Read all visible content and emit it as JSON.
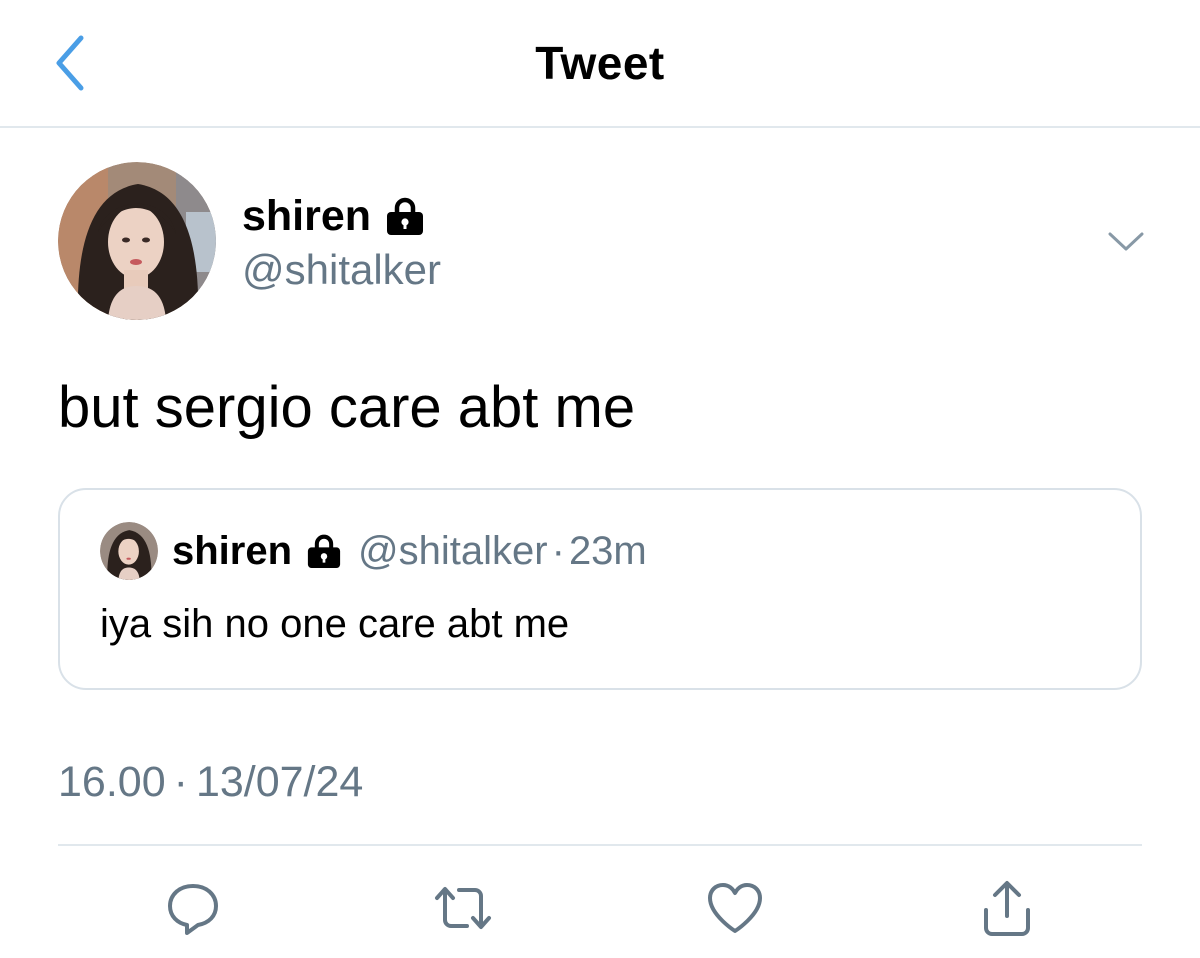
{
  "header": {
    "title": "Tweet",
    "back_icon": "chevron-left-icon",
    "accent_color": "#4a9ee6"
  },
  "author": {
    "display_name": "shiren",
    "handle": "@shitalker",
    "protected_icon": "lock-icon",
    "menu_icon": "chevron-down-icon"
  },
  "tweet": {
    "text": "but sergio care abt me"
  },
  "quoted_tweet": {
    "display_name": "shiren",
    "protected_icon": "lock-icon",
    "handle": "@shitalker",
    "separator": "·",
    "time_ago": "23m",
    "text": "iya sih no one care abt me"
  },
  "timestamp": {
    "time": "16.00",
    "separator": "·",
    "date": "13/07/24"
  },
  "actions": [
    {
      "icon": "reply-icon"
    },
    {
      "icon": "retweet-icon"
    },
    {
      "icon": "like-icon"
    },
    {
      "icon": "share-icon"
    }
  ],
  "colors": {
    "text_primary": "#000000",
    "text_secondary": "#657786",
    "border": "#e1e8ed"
  }
}
